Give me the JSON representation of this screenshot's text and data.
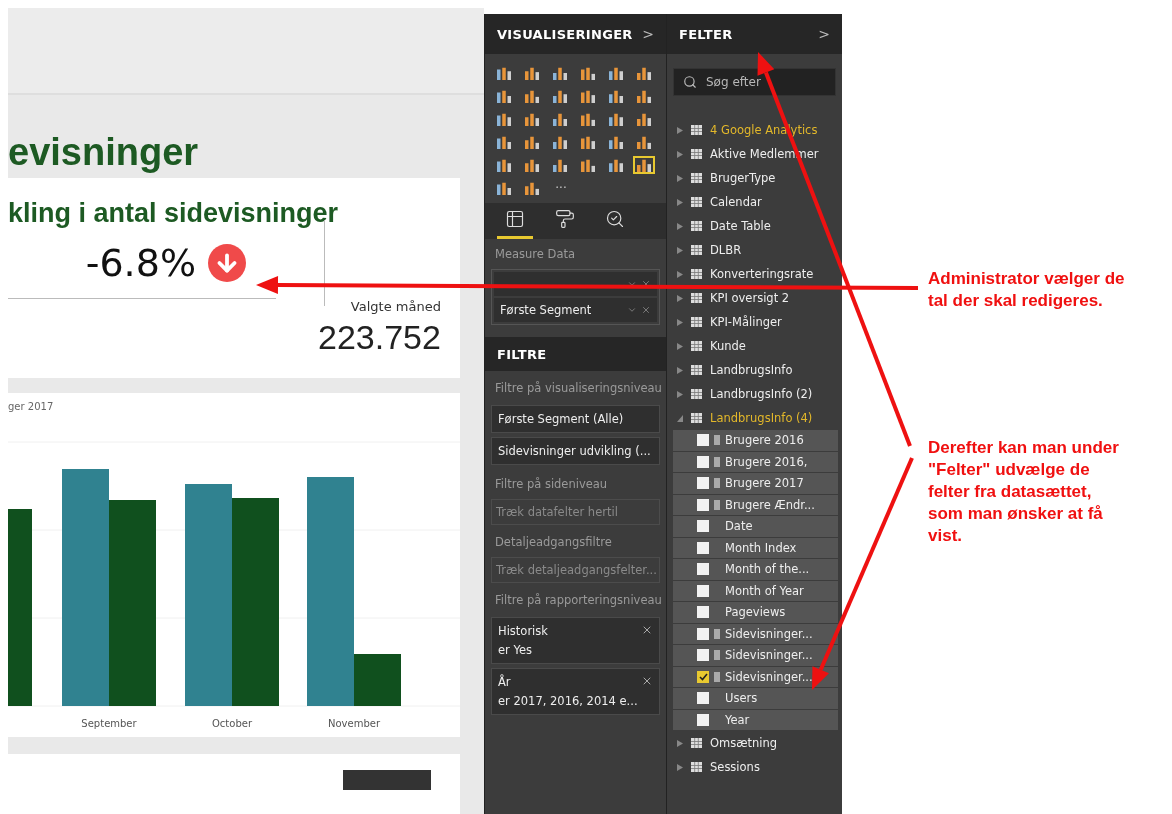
{
  "report": {
    "title": "evisninger",
    "kpi_card": {
      "title": "kling i antal sidevisninger",
      "value": "-6.8%",
      "negative": true,
      "side_label": "Valgte måned",
      "side_value": "223.752"
    },
    "chart_card": {
      "title": "ger 2017",
      "x_labels": [
        "September",
        "October",
        "November"
      ]
    }
  },
  "visualizations": {
    "title": "VISUALISERINGER",
    "chevron": ">",
    "types": [
      {
        "selected": false
      },
      {
        "selected": false
      },
      {
        "selected": false
      },
      {
        "selected": false
      },
      {
        "selected": false
      },
      {
        "selected": false
      },
      {
        "selected": false
      },
      {
        "selected": false
      },
      {
        "selected": false
      },
      {
        "selected": false
      },
      {
        "selected": false
      },
      {
        "selected": false
      },
      {
        "selected": false
      },
      {
        "selected": false
      },
      {
        "selected": false
      },
      {
        "selected": false
      },
      {
        "selected": false
      },
      {
        "selected": false
      },
      {
        "selected": false
      },
      {
        "selected": false
      },
      {
        "selected": false
      },
      {
        "selected": false
      },
      {
        "selected": false
      },
      {
        "selected": false
      },
      {
        "selected": false
      },
      {
        "selected": false
      },
      {
        "selected": false
      },
      {
        "selected": false
      },
      {
        "selected": false
      },
      {
        "selected": true
      },
      {
        "selected": false
      },
      {
        "selected": false
      }
    ],
    "more": "···",
    "tabs": [
      {
        "kind": "fields",
        "selected": true
      },
      {
        "kind": "format",
        "selected": false
      },
      {
        "kind": "analytics",
        "selected": false
      }
    ],
    "well_label": "Measure Data",
    "wells": [
      {
        "kind": "covered"
      },
      {
        "kind": "field",
        "name": "Første Segment"
      }
    ]
  },
  "filters": {
    "title": "FILTRE",
    "sections": [
      {
        "label": "Filtre på visualiseringsniveau",
        "kind": "cards",
        "items": [
          {
            "title": "Første Segment (Alle)"
          },
          {
            "title": "Sidevisninger udvikling (..."
          }
        ]
      },
      {
        "label": "Filtre på sideniveau",
        "kind": "drop",
        "drop": "Træk datafelter hertil"
      },
      {
        "label": "Detaljeadgangsfiltre",
        "kind": "drop",
        "drop": "Træk detaljeadgangsfelter..."
      },
      {
        "label": "Filtre på rapporteringsniveau",
        "kind": "cards",
        "items": [
          {
            "title": "Historisk",
            "value": "er Yes"
          },
          {
            "title": "År",
            "value": "er 2017, 2016, 2014 e..."
          }
        ]
      }
    ]
  },
  "fields": {
    "title": "FELTER",
    "chevron": ">",
    "search": {
      "placeholder": "Søg efter"
    },
    "tables": [
      {
        "name": "4 Google Analytics",
        "highlighted": true,
        "expanded": false
      },
      {
        "name": "Aktive Medlemmer",
        "highlighted": false,
        "expanded": false
      },
      {
        "name": "BrugerType",
        "highlighted": false,
        "expanded": false
      },
      {
        "name": "Calendar",
        "highlighted": false,
        "expanded": false
      },
      {
        "name": "Date Table",
        "highlighted": false,
        "expanded": false
      },
      {
        "name": "DLBR",
        "highlighted": false,
        "expanded": false
      },
      {
        "name": "Konverteringsrate",
        "highlighted": false,
        "expanded": false
      },
      {
        "name": "KPI oversigt 2",
        "highlighted": false,
        "expanded": false
      },
      {
        "name": "KPI-Målinger",
        "highlighted": false,
        "expanded": false
      },
      {
        "name": "Kunde",
        "highlighted": false,
        "expanded": false
      },
      {
        "name": "LandbrugsInfo",
        "highlighted": false,
        "expanded": false
      },
      {
        "name": "LandbrugsInfo (2)",
        "highlighted": false,
        "expanded": false
      },
      {
        "name": "LandbrugsInfo (4)",
        "highlighted": true,
        "expanded": true,
        "children": [
          {
            "name": "Brugere 2016",
            "kind": "measure",
            "checked": false
          },
          {
            "name": "Brugere 2016,",
            "kind": "measure",
            "checked": false
          },
          {
            "name": "Brugere 2017",
            "kind": "measure",
            "checked": false
          },
          {
            "name": "Brugere Ændr...",
            "kind": "measure",
            "checked": false
          },
          {
            "name": "Date",
            "kind": "column",
            "checked": false
          },
          {
            "name": "Month Index",
            "kind": "column",
            "checked": false
          },
          {
            "name": "Month of the...",
            "kind": "column",
            "checked": false
          },
          {
            "name": "Month of Year",
            "kind": "column",
            "checked": false
          },
          {
            "name": "Pageviews",
            "kind": "column",
            "checked": false
          },
          {
            "name": "Sidevisninger...",
            "kind": "measure",
            "checked": false
          },
          {
            "name": "Sidevisninger...",
            "kind": "measure",
            "checked": false
          },
          {
            "name": "Sidevisninger...",
            "kind": "measure",
            "checked": true
          },
          {
            "name": "Users",
            "kind": "column",
            "checked": false
          },
          {
            "name": "Year",
            "kind": "column",
            "checked": false
          }
        ]
      },
      {
        "name": "Omsætning",
        "highlighted": false,
        "expanded": false
      },
      {
        "name": "Sessions",
        "highlighted": false,
        "expanded": false
      }
    ]
  },
  "annotations": [
    {
      "text": "Administrator vælger de tal der skal redigeres."
    },
    {
      "text": "Derefter kan man under \"Felter\" udvælge de felter fra datasættet, som man ønsker at få vist."
    }
  ]
}
